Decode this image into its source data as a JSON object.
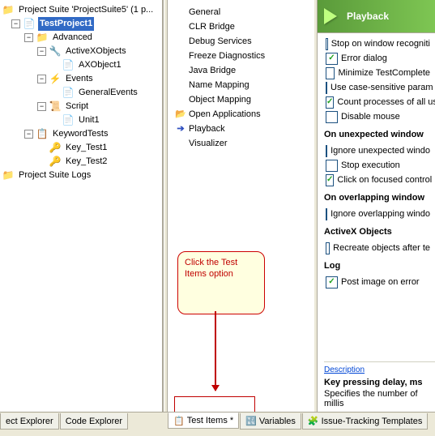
{
  "tree": {
    "root": "Project Suite 'ProjectSuite5' (1 p...",
    "project": "TestProject1",
    "advanced": "Advanced",
    "activex": "ActiveXObjects",
    "axobj": "AXObject1",
    "events": "Events",
    "genevents": "GeneralEvents",
    "script": "Script",
    "unit1": "Unit1",
    "kwtests": "KeywordTests",
    "kt1": "Key_Test1",
    "kt2": "Key_Test2",
    "logs": "Project Suite Logs"
  },
  "cats": {
    "general": "General",
    "clr": "CLR Bridge",
    "debug": "Debug Services",
    "freeze": "Freeze Diagnostics",
    "java": "Java Bridge",
    "namemap": "Name Mapping",
    "objmap": "Object Mapping",
    "openapp": "Open Applications",
    "playback": "Playback",
    "visual": "Visualizer"
  },
  "header": "Playback",
  "opts": {
    "stopwin": "Stop on window recogniti",
    "errdlg": "Error dialog",
    "mintc": "Minimize TestComplete",
    "usecase": "Use case-sensitive param",
    "countproc": "Count processes of all us",
    "dismouse": "Disable mouse",
    "sec_unexp": "On unexpected window",
    "ignunexp": "Ignore unexpected windo",
    "stopexec": "Stop execution",
    "clickfoc": "Click on focused control",
    "sec_overlap": "On overlapping window",
    "ignoverlap": "Ignore overlapping windo",
    "sec_ax": "ActiveX Objects",
    "recreate": "Recreate objects after te",
    "sec_log": "Log",
    "postimg": "Post image on error"
  },
  "desc": {
    "title": "Description",
    "key": "Key pressing delay, ms",
    "txt": "Specifies the number of millis"
  },
  "callout": "Click the Test Items option",
  "tabs": {
    "pexp": "ect Explorer",
    "cexp": "Code Explorer",
    "testitems": "Test Items *",
    "vars": "Variables",
    "issue": "Issue-Tracking Templates"
  }
}
